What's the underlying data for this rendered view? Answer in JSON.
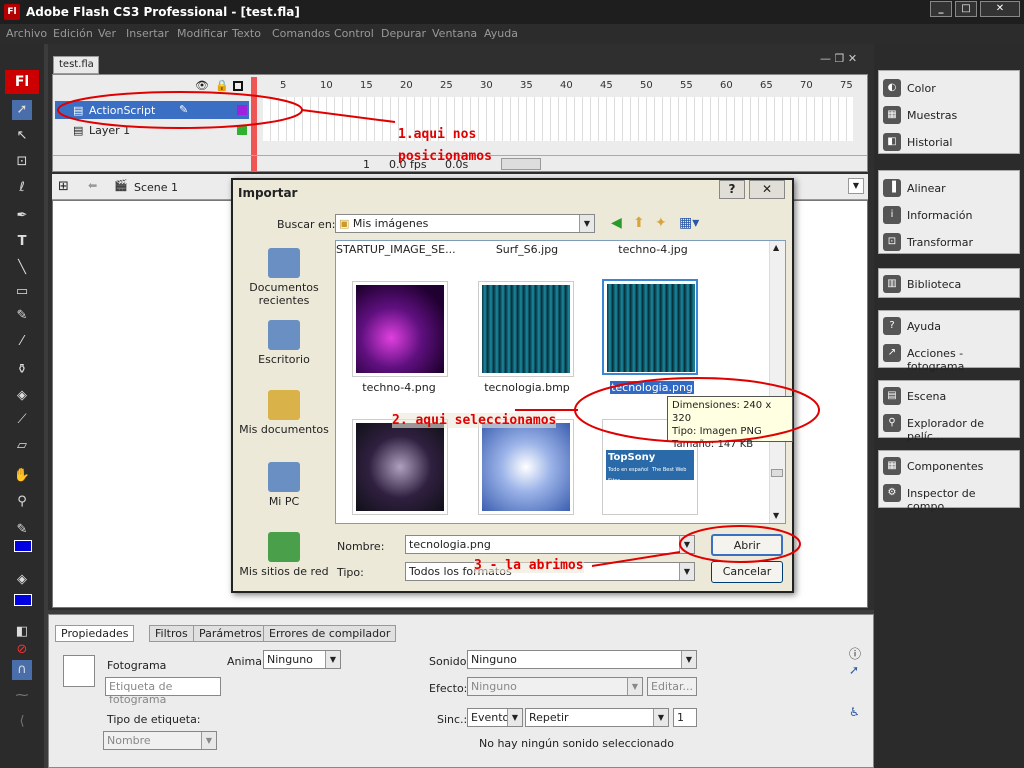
{
  "window": {
    "title": "Adobe Flash CS3 Professional - [test.fla]",
    "logo": "Fl"
  },
  "menu": [
    "Archivo",
    "Edición",
    "Ver",
    "Insertar",
    "Modificar",
    "Texto",
    "Comandos",
    "Control",
    "Depurar",
    "Ventana",
    "Ayuda"
  ],
  "document_tab": "test.fla",
  "timeline": {
    "frame_numbers": [
      "5",
      "10",
      "15",
      "20",
      "25",
      "30",
      "35",
      "40",
      "45",
      "50",
      "55",
      "60",
      "65",
      "70",
      "75"
    ],
    "layers": [
      {
        "name": "ActionScript",
        "selected": true
      },
      {
        "name": "Layer 1",
        "selected": false
      }
    ],
    "status": {
      "frame": "1",
      "fps": "0.0 fps",
      "time": "0.0s"
    }
  },
  "scene": "Scene 1",
  "dialog": {
    "title": "Importar",
    "look_in_label": "Buscar en:",
    "look_in_value": "Mis imágenes",
    "places": [
      "Documentos recientes",
      "Escritorio",
      "Mis documentos",
      "Mi PC",
      "Mis sitios de red"
    ],
    "top_row_files": [
      "STARTUP_IMAGE_SE...",
      "Surf_S6.jpg",
      "techno-4.jpg"
    ],
    "files": [
      {
        "name": "techno-4.png"
      },
      {
        "name": "tecnologia.bmp"
      },
      {
        "name": "tecnologia.png"
      }
    ],
    "bottom_thumb_text": [
      "TopSony",
      "Todo en español",
      "The Best Web Sites"
    ],
    "tooltip": [
      "Dimensiones: 240 x 320",
      "Tipo: Imagen PNG",
      "Tamaño: 147 KB"
    ],
    "name_label": "Nombre:",
    "name_value": "tecnologia.png",
    "type_label": "Tipo:",
    "type_value": "Todos los formatos",
    "open_button": "Abrir",
    "cancel_button": "Cancelar"
  },
  "right_panel": {
    "groups": [
      [
        "Color",
        "Muestras",
        "Historial"
      ],
      [
        "Alinear",
        "Información",
        "Transformar"
      ],
      [
        "Biblioteca"
      ],
      [
        "Ayuda",
        "Acciones - fotograma"
      ],
      [
        "Escena",
        "Explorador de pelíc..."
      ],
      [
        "Componentes",
        "Inspector de compo..."
      ]
    ]
  },
  "properties": {
    "tabs": [
      "Propiedades",
      "Filtros",
      "Parámetros",
      "Errores de compilador"
    ],
    "frame_label": "Fotograma",
    "frame_name_placeholder": "Etiqueta de fotograma",
    "tween_label": "Animar:",
    "tween_value": "Ninguno",
    "label_type_label": "Tipo de etiqueta:",
    "label_type_value": "Nombre",
    "sound_label": "Sonido:",
    "sound_value": "Ninguno",
    "effect_label": "Efecto:",
    "effect_value": "Ninguno",
    "edit_button": "Editar...",
    "sync_label": "Sinc.:",
    "sync_value": "Evento",
    "repeat_value": "Repetir",
    "repeat_count": "1",
    "no_sound": "No hay ningún sonido seleccionado"
  },
  "annotations": {
    "step1": "1.aqui nos posicionamos",
    "step2": "2. aqui seleccionamos",
    "step3": "3 - la abrimos"
  },
  "colors": {
    "annotation": "#e00000",
    "selected_layer": "#3a6fc4",
    "flash_red": "#c00000"
  }
}
